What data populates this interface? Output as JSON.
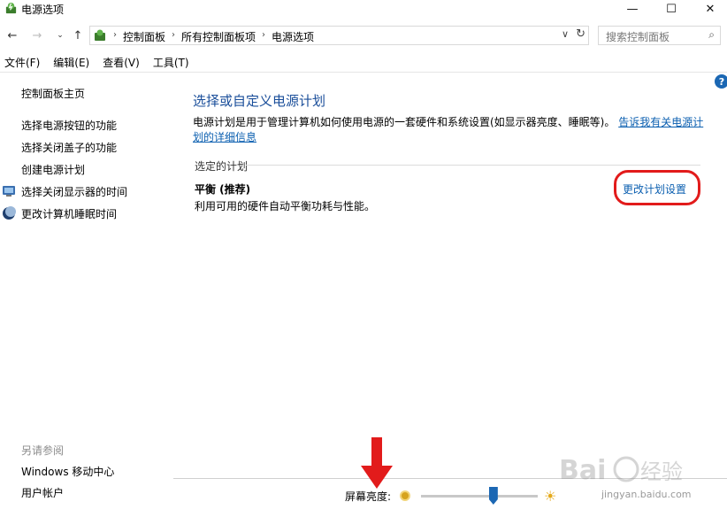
{
  "window": {
    "title": "电源选项",
    "controls": {
      "minimize": "—",
      "maximize": "☐",
      "close": "✕"
    }
  },
  "navigation": {
    "back_icon": "arrow-left-icon",
    "forward_icon": "arrow-right-icon",
    "up_icon": "arrow-up-icon",
    "breadcrumbs": [
      "控制面板",
      "所有控制面板项",
      "电源选项"
    ],
    "search_placeholder": "搜索控制面板"
  },
  "menu": [
    "文件(F)",
    "编辑(E)",
    "查看(V)",
    "工具(T)"
  ],
  "sidebar": {
    "home": "控制面板主页",
    "links": [
      {
        "label": "选择电源按钮的功能"
      },
      {
        "label": "选择关闭盖子的功能"
      },
      {
        "label": "创建电源计划"
      },
      {
        "label": "选择关闭显示器的时间",
        "icon": "monitor-icon"
      },
      {
        "label": "更改计算机睡眠时间",
        "icon": "moon-icon"
      }
    ],
    "see_also_label": "另请参阅",
    "see_also": [
      "Windows 移动中心",
      "用户帐户"
    ]
  },
  "main": {
    "heading": "选择或自定义电源计划",
    "description": "电源计划是用于管理计算机如何使用电源的一套硬件和系统设置(如显示器亮度、睡眠等)。",
    "description_link": "告诉我有关电源计划的详细信息",
    "group_label": "选定的计划",
    "plan_name": "平衡 (推荐)",
    "plan_description": "利用可用的硬件自动平衡功耗与性能。",
    "plan_link": "更改计划设置"
  },
  "bottom": {
    "brightness_label": "屏幕亮度:",
    "brightness_level": 0.62
  },
  "watermark": {
    "url": "jingyan.baidu.com"
  },
  "colors": {
    "link": "#0b5fb0",
    "heading": "#1a4e9a",
    "highlight": "#e21b1b",
    "accent": "#1b67b3"
  }
}
